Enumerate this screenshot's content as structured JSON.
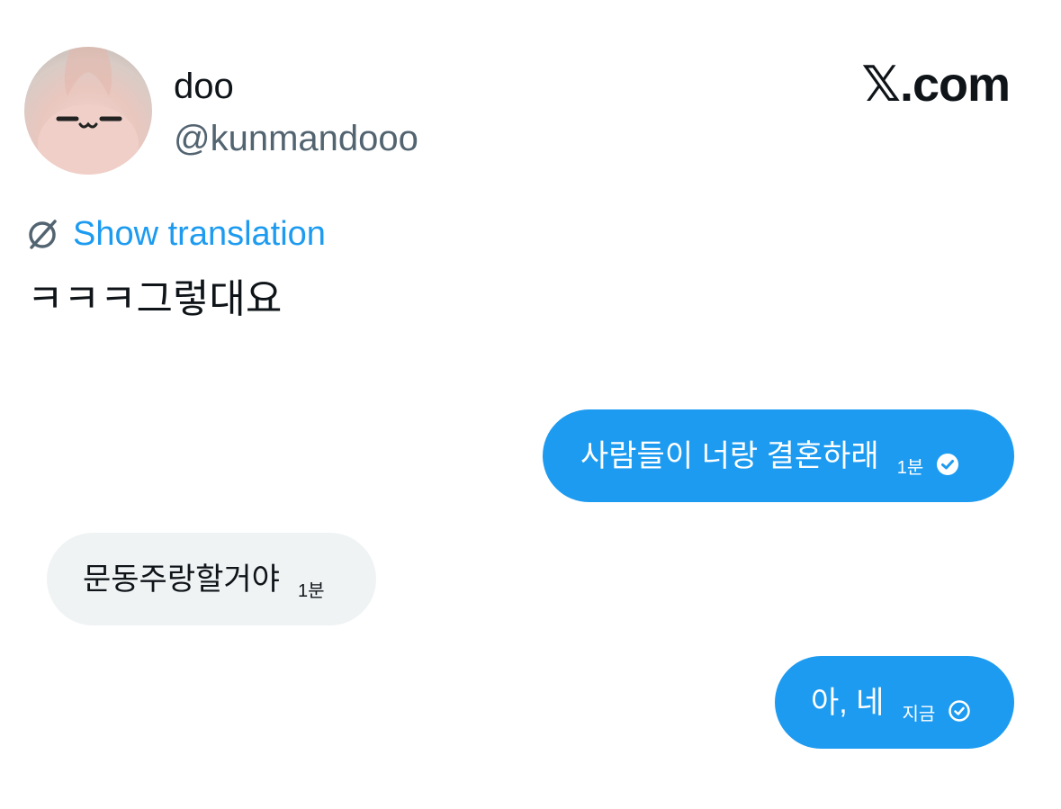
{
  "header": {
    "display_name": "doo",
    "handle": "@kunmandooo",
    "brand": "𝕏.com",
    "avatar_icon": "avatar-icon"
  },
  "translate": {
    "label": "Show translation",
    "icon": "no-translate-icon"
  },
  "tweet": {
    "text": "ㅋㅋㅋ그렇대요"
  },
  "messages": [
    {
      "side": "sent",
      "text": "사람들이 너랑 결혼하래",
      "time": "1분",
      "status_icon": "check-circle-filled-icon"
    },
    {
      "side": "received",
      "text": "문동주랑할거야",
      "time": "1분"
    },
    {
      "side": "sent",
      "text": "아, 네",
      "time": "지금",
      "status_icon": "check-circle-outline-icon"
    }
  ],
  "colors": {
    "accent": "#1d9bf0",
    "received_bubble": "#eff3f4",
    "text_primary": "#0f1419",
    "text_secondary": "#536471"
  }
}
